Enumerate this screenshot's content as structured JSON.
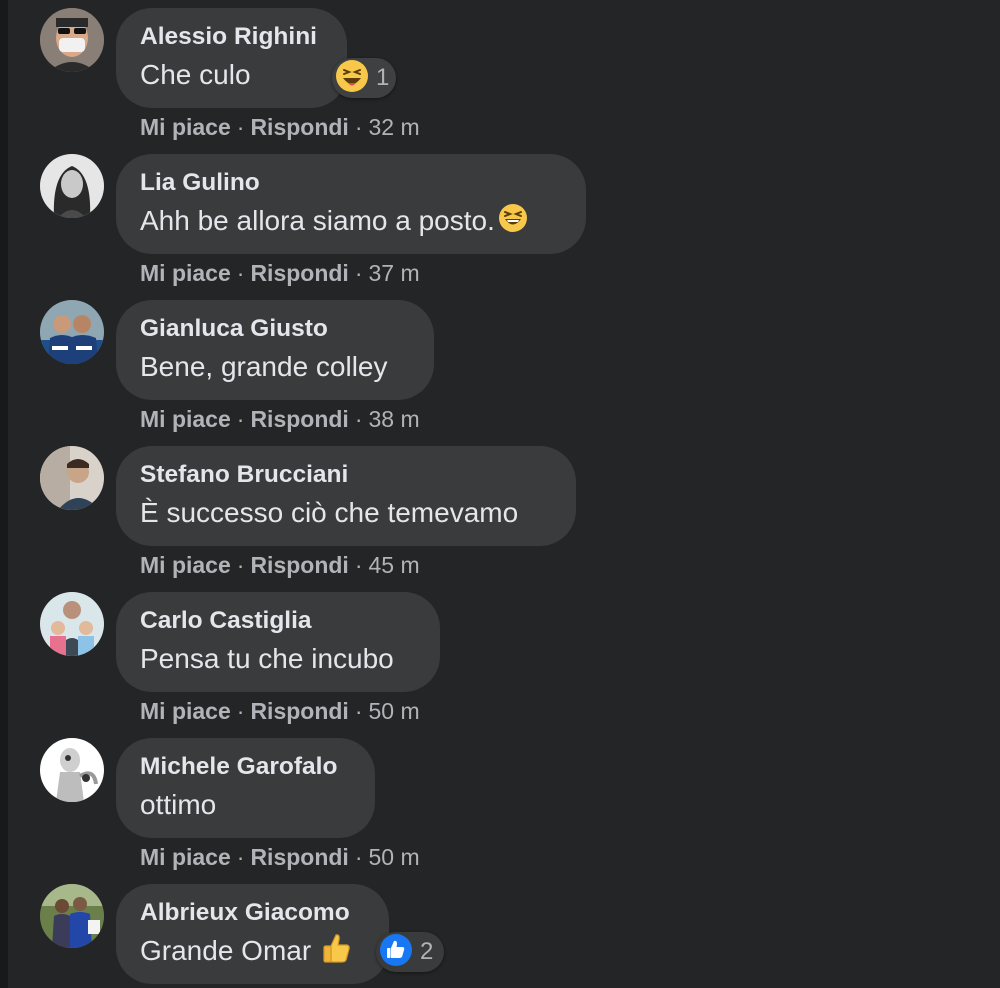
{
  "comments": [
    {
      "author": "Alessio Righini",
      "text": "Che culo",
      "like": "Mi piace",
      "reply": "Rispondi",
      "time": "32 m",
      "reaction": {
        "icon": "laughing-emoji-icon",
        "count": "1"
      }
    },
    {
      "author": "Lia Gulino",
      "text": "Ahh be allora siamo a posto.",
      "inline_emoji": "grinning-squint-emoji-icon",
      "like": "Mi piace",
      "reply": "Rispondi",
      "time": "37 m"
    },
    {
      "author": "Gianluca Giusto",
      "text": "Bene, grande colley",
      "like": "Mi piace",
      "reply": "Rispondi",
      "time": "38 m"
    },
    {
      "author": "Stefano Brucciani",
      "text": "È successo ciò che temevamo",
      "like": "Mi piace",
      "reply": "Rispondi",
      "time": "45 m"
    },
    {
      "author": "Carlo Castiglia",
      "text": "Pensa tu che incubo",
      "like": "Mi piace",
      "reply": "Rispondi",
      "time": "50 m"
    },
    {
      "author": "Michele Garofalo",
      "text": "ottimo",
      "like": "Mi piace",
      "reply": "Rispondi",
      "time": "50 m"
    },
    {
      "author": "Albrieux Giacomo",
      "text": "Grande Omar",
      "inline_emoji": "thumbs-up-emoji-icon",
      "reaction": {
        "icon": "like-icon",
        "count": "2"
      }
    }
  ],
  "colors": {
    "background": "#242526",
    "bubble": "#3a3b3c",
    "primary_text": "#e4e6eb",
    "secondary_text": "#b0b3b8",
    "like_blue": "#1877f2",
    "emoji_yellow": "#f7c84a"
  }
}
